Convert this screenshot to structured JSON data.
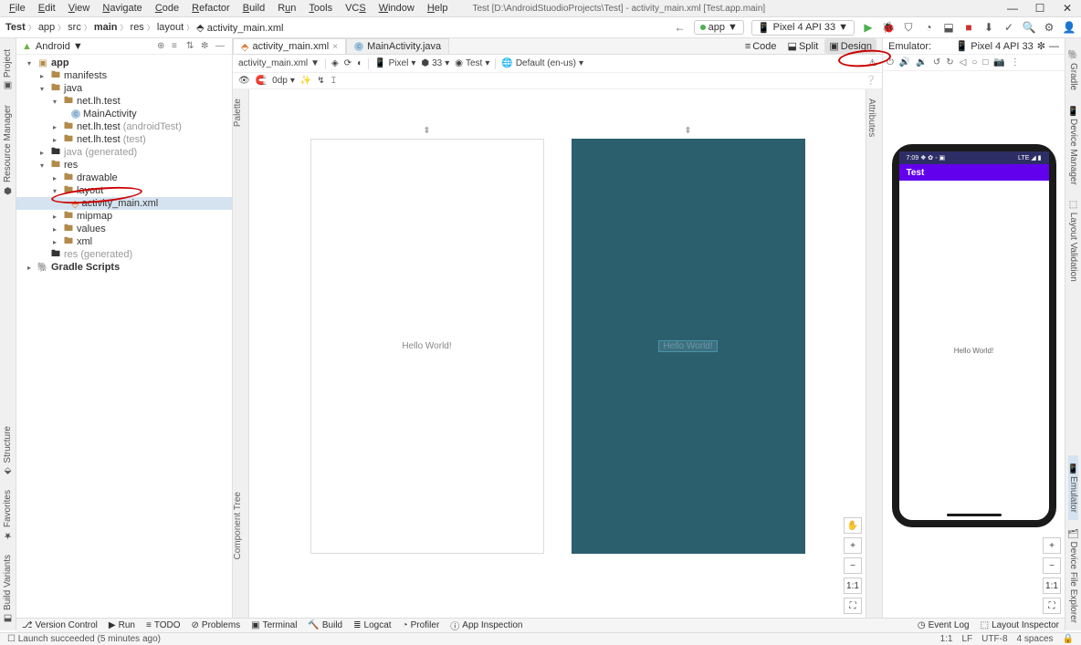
{
  "menu": {
    "items": [
      "File",
      "Edit",
      "View",
      "Navigate",
      "Code",
      "Refactor",
      "Build",
      "Run",
      "Tools",
      "VCS",
      "Window",
      "Help"
    ],
    "title": "Test [D:\\AndroidStuodioProjects\\Test] - activity_main.xml [Test.app.main]"
  },
  "win_controls": {
    "min": "—",
    "max": "☐",
    "close": "✕"
  },
  "breadcrumb": [
    "Test",
    "app",
    "src",
    "main",
    "res",
    "layout",
    "activity_main.xml"
  ],
  "nav": {
    "app": "app",
    "ar": "▼",
    "device": "Pixel 4 API 33",
    "dar": "▼"
  },
  "left_ribbon": [
    "Project",
    "Resource Manager"
  ],
  "left_ribbon_bottom": [
    "Structure",
    "Favorites",
    "Build Variants"
  ],
  "right_ribbon": [
    "Gradle",
    "Device Manager",
    "Layout Validation"
  ],
  "right_ribbon_bottom": [
    "Emulator",
    "Device File Explorer"
  ],
  "project_header": {
    "title": "Android",
    "ar": "▼"
  },
  "tree": {
    "app": "app",
    "manifests": "manifests",
    "java": "java",
    "pkg1": "net.lh.test",
    "main_activity": "MainActivity",
    "pkg2": "net.lh.test",
    "pkg2_suf": " (androidTest)",
    "pkg3": "net.lh.test",
    "pkg3_suf": " (test)",
    "java_gen": "java",
    "java_gen_suf": " (generated)",
    "res": "res",
    "drawable": "drawable",
    "layout": "layout",
    "activity_main": "activity_main.xml",
    "mipmap": "mipmap",
    "values": "values",
    "xml": "xml",
    "res_gen": "res",
    "res_gen_suf": " (generated)",
    "gradle": "Gradle Scripts"
  },
  "tabs": {
    "t1": "activity_main.xml",
    "t2": "MainActivity.java"
  },
  "view_switch": {
    "code": "Code",
    "split": "Split",
    "design": "Design"
  },
  "design_toolbar": {
    "file": "activity_main.xml",
    "ar": "▼",
    "pixel": "Pixel",
    "api": "33",
    "theme": "Test",
    "locale": "Default (en-us)"
  },
  "design_toolbar2": {
    "dp": "0dp"
  },
  "canvas": {
    "hello": "Hello World!"
  },
  "palette_label": "Palette",
  "comptree_label": "Component Tree",
  "attr_label": "Attributes",
  "emu": {
    "header": "Emulator:",
    "device": "Pixel 4 API 33",
    "status_time": "7:09 ❖ ✿ ◦ ▣",
    "status_right": "LTE ◢ ▮",
    "appbar": "Test",
    "hello": "Hello World!"
  },
  "zoom": {
    "pan": "✋",
    "plus": "+",
    "minus": "−",
    "fit": "1:1",
    "full": "⛶"
  },
  "toolstrip": {
    "vc": "Version Control",
    "run": "Run",
    "todo": "TODO",
    "problems": "Problems",
    "terminal": "Terminal",
    "build": "Build",
    "logcat": "Logcat",
    "profiler": "Profiler",
    "appinsp": "App Inspection",
    "eventlog": "Event Log",
    "layoutinsp": "Layout Inspector"
  },
  "statusbar": {
    "msg": "Launch succeeded (5 minutes ago)",
    "pos": "1:1",
    "enc": "LF",
    "ind": "UTF-8",
    "sp": "4 spaces"
  }
}
